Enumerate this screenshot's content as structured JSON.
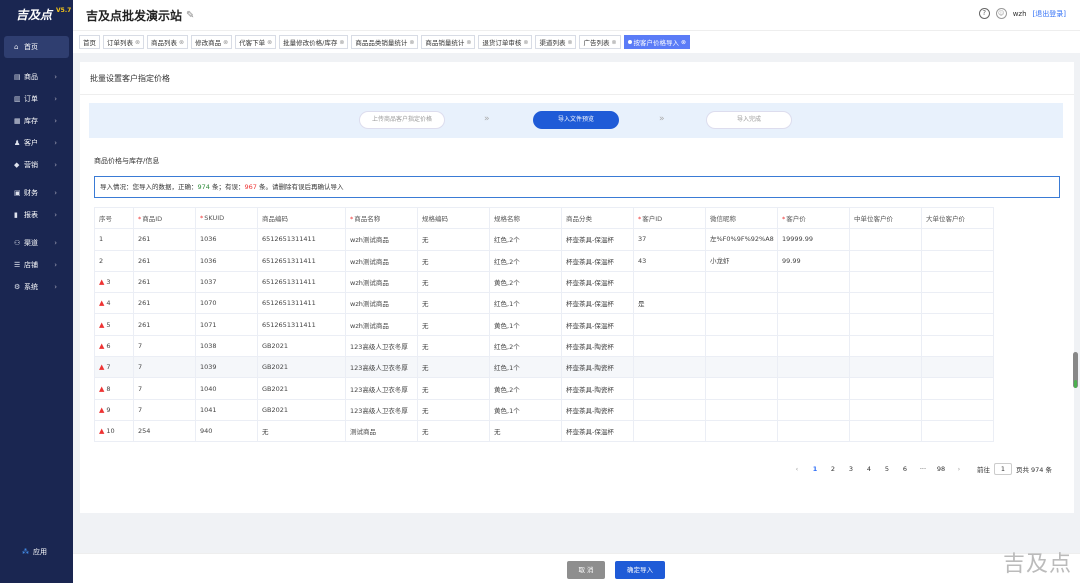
{
  "brand": {
    "logo": "吉及点",
    "version": "V5.7"
  },
  "header": {
    "title": "吉及点批发演示站",
    "user": "wzh",
    "logout": "[退出登录]"
  },
  "sidebar": {
    "items": [
      {
        "icon": "⌂",
        "label": "首页",
        "arrow": ""
      },
      {
        "icon": "▤",
        "label": "商品",
        "arrow": "›"
      },
      {
        "icon": "▥",
        "label": "订单",
        "arrow": "›"
      },
      {
        "icon": "▦",
        "label": "库存",
        "arrow": "›"
      },
      {
        "icon": "♟",
        "label": "客户",
        "arrow": "›"
      },
      {
        "icon": "◆",
        "label": "营销",
        "arrow": "›"
      },
      {
        "icon": "▣",
        "label": "财务",
        "arrow": "›"
      },
      {
        "icon": "▮",
        "label": "报表",
        "arrow": "›"
      },
      {
        "icon": "⚇",
        "label": "渠道",
        "arrow": "›"
      },
      {
        "icon": "☰",
        "label": "店铺",
        "arrow": "›"
      },
      {
        "icon": "⚙",
        "label": "系统",
        "arrow": "›"
      }
    ],
    "apps": "应用"
  },
  "tabs": [
    "首页",
    "订单列表",
    "商品列表",
    "修改商品",
    "代客下单",
    "批量修改价格/库存",
    "商品品类销量统计",
    "商品销量统计",
    "退货订单审核",
    "渠道列表",
    "广告列表",
    "按客户价格导入"
  ],
  "page": {
    "title": "批量设置客户指定价格",
    "steps": [
      "上传商品客户指定价格",
      "导入文件预览",
      "导入完成"
    ],
    "section": "商品价格与库存/信息",
    "notice": {
      "pre": "导入情况：您导入的数据，正确：",
      "ok": "974",
      "mid": " 条；有误：",
      "bad": "967",
      "post": " 条。请删除有误后再确认导入"
    }
  },
  "table": {
    "headers": [
      {
        "t": "序号",
        "r": false
      },
      {
        "t": "商品ID",
        "r": true
      },
      {
        "t": "SKUID",
        "r": true
      },
      {
        "t": "商品编码",
        "r": false
      },
      {
        "t": "商品名称",
        "r": true
      },
      {
        "t": "规格编码",
        "r": false
      },
      {
        "t": "规格名称",
        "r": false
      },
      {
        "t": "商品分类",
        "r": false
      },
      {
        "t": "客户ID",
        "r": true
      },
      {
        "t": "微信昵称",
        "r": false
      },
      {
        "t": "客户价",
        "r": true
      },
      {
        "t": "中单位客户价",
        "r": false
      },
      {
        "t": "大单位客户价",
        "r": false
      }
    ],
    "rows": [
      {
        "w": false,
        "c": [
          "1",
          "261",
          "1036",
          "6512651311411",
          "wzh测试商品",
          "无",
          "红色,2个",
          "杯壶茶具-保温杯",
          "37",
          "左%F0%9F%92%A8",
          "19999.99",
          "",
          ""
        ]
      },
      {
        "w": false,
        "c": [
          "2",
          "261",
          "1036",
          "6512651311411",
          "wzh测试商品",
          "无",
          "红色,2个",
          "杯壶茶具-保温杯",
          "43",
          "小龙虾",
          "99.99",
          "",
          ""
        ]
      },
      {
        "w": true,
        "c": [
          "3",
          "261",
          "1037",
          "6512651311411",
          "wzh测试商品",
          "无",
          "黄色,2个",
          "杯壶茶具-保温杯",
          "",
          "",
          "",
          "",
          ""
        ]
      },
      {
        "w": true,
        "c": [
          "4",
          "261",
          "1070",
          "6512651311411",
          "wzh测试商品",
          "无",
          "红色,1个",
          "杯壶茶具-保温杯",
          "是",
          "",
          "",
          "",
          ""
        ]
      },
      {
        "w": true,
        "c": [
          "5",
          "261",
          "1071",
          "6512651311411",
          "wzh测试商品",
          "无",
          "黄色,1个",
          "杯壶茶具-保温杯",
          "",
          "",
          "",
          "",
          ""
        ]
      },
      {
        "w": true,
        "c": [
          "6",
          "7",
          "1038",
          "GB2021",
          "123高级人卫衣冬厚",
          "无",
          "红色,2个",
          "杯壶茶具-陶瓷杯",
          "",
          "",
          "",
          "",
          ""
        ]
      },
      {
        "w": true,
        "c": [
          "7",
          "7",
          "1039",
          "GB2021",
          "123高级人卫衣冬厚",
          "无",
          "红色,1个",
          "杯壶茶具-陶瓷杯",
          "",
          "",
          "",
          "",
          ""
        ]
      },
      {
        "w": true,
        "c": [
          "8",
          "7",
          "1040",
          "GB2021",
          "123高级人卫衣冬厚",
          "无",
          "黄色,2个",
          "杯壶茶具-陶瓷杯",
          "",
          "",
          "",
          "",
          ""
        ]
      },
      {
        "w": true,
        "c": [
          "9",
          "7",
          "1041",
          "GB2021",
          "123高级人卫衣冬厚",
          "无",
          "黄色,1个",
          "杯壶茶具-陶瓷杯",
          "",
          "",
          "",
          "",
          ""
        ]
      },
      {
        "w": true,
        "c": [
          "10",
          "254",
          "940",
          "无",
          "测试商品",
          "无",
          "无",
          "杯壶茶具-保温杯",
          "",
          "",
          "",
          "",
          ""
        ]
      }
    ]
  },
  "pager": {
    "prev": "‹",
    "pages": [
      "1",
      "2",
      "3",
      "4",
      "5",
      "6",
      "···",
      "98"
    ],
    "next": "›",
    "goto": "前往",
    "current": "1",
    "total": "页共 974 条"
  },
  "footer": {
    "cancel": "取 消",
    "confirm": "确定导入"
  },
  "watermark": "吉及点"
}
